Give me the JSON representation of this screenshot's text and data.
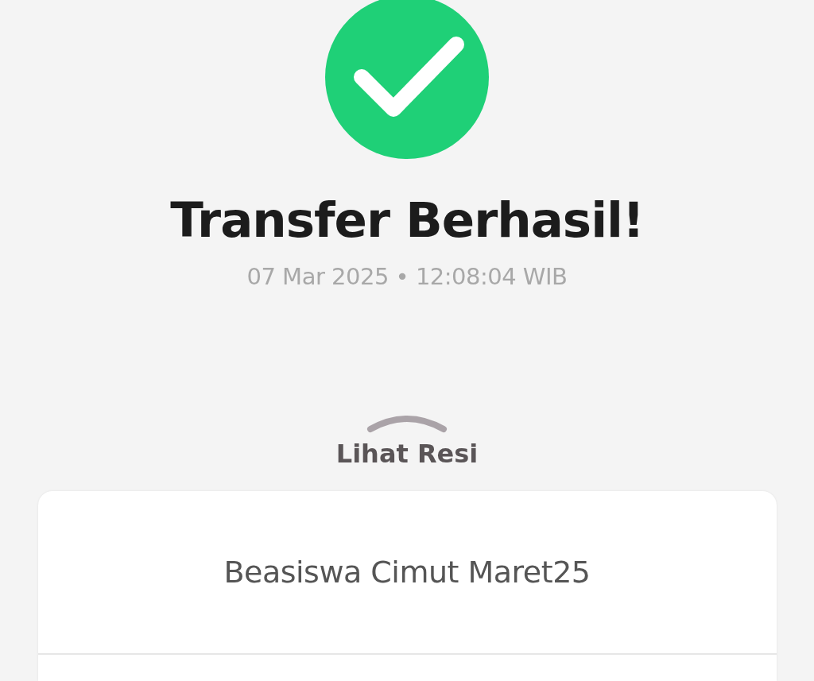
{
  "status": {
    "title": "Transfer Berhasil!",
    "datetime": "07 Mar 2025 • 12:08:04 WIB"
  },
  "receipt": {
    "toggle_label": "Lihat Resi",
    "expanded": false,
    "note": "Beasiswa Cimut Maret25"
  }
}
